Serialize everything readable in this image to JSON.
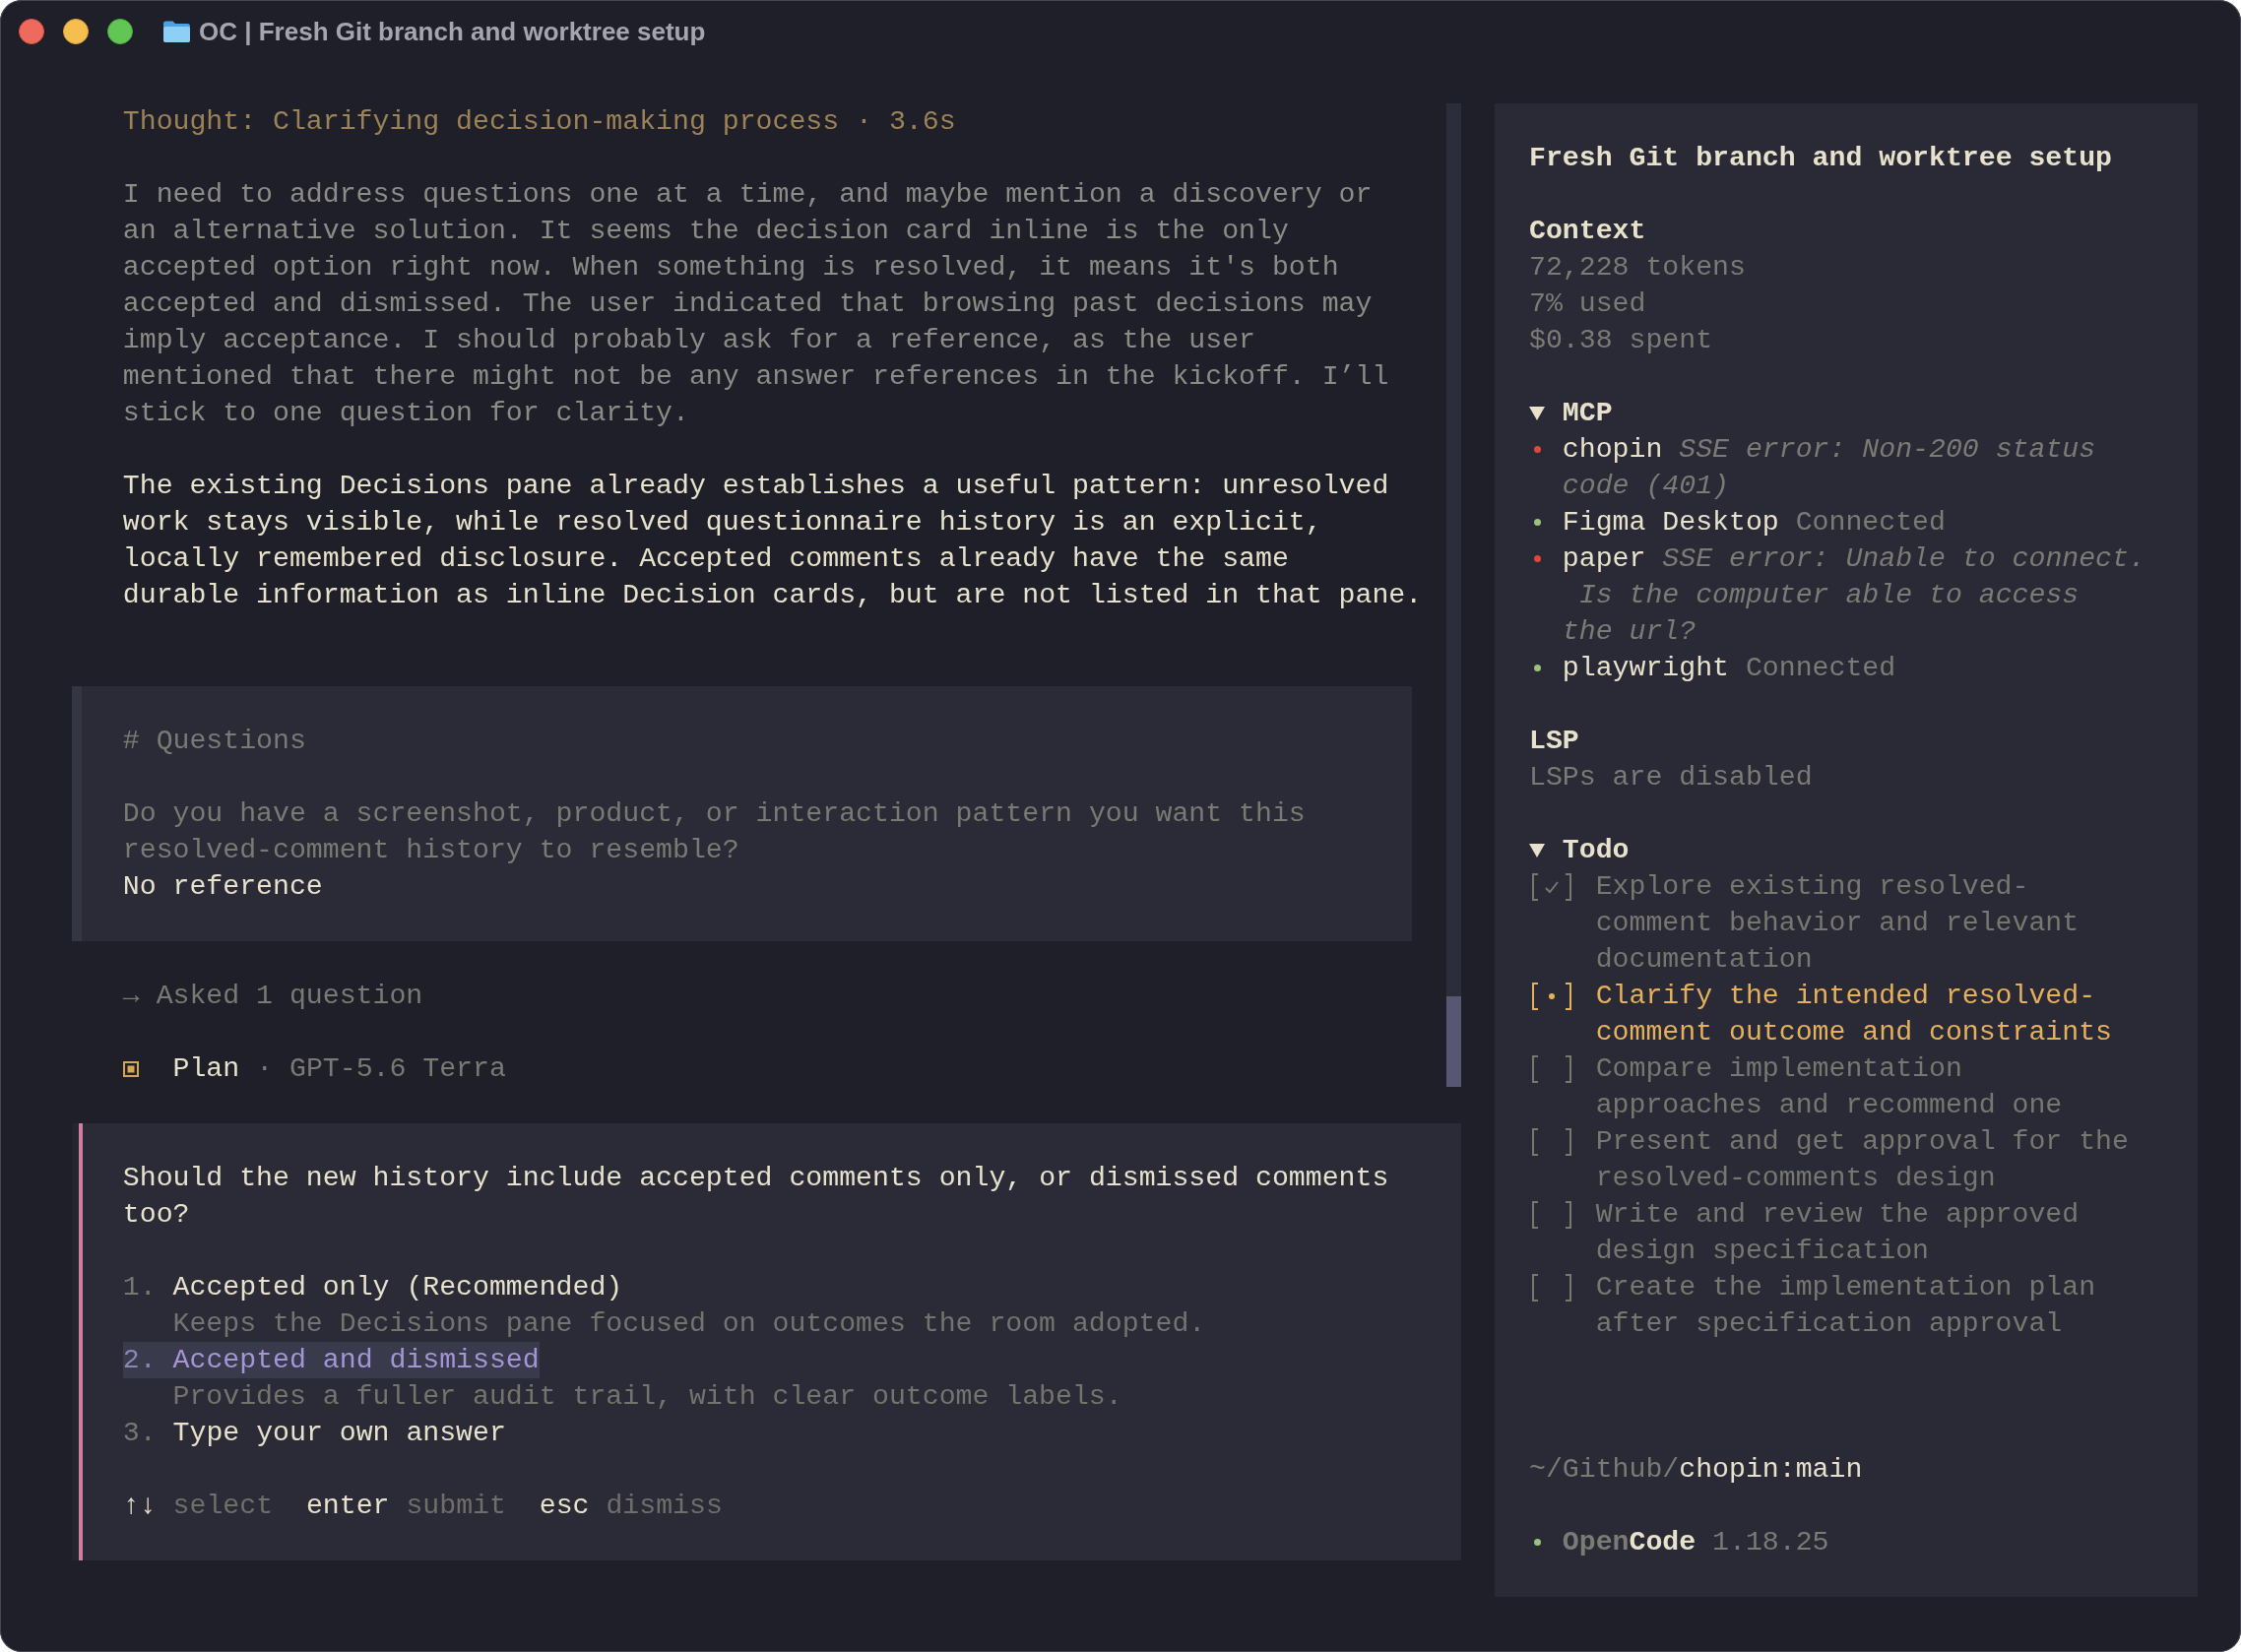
{
  "window": {
    "title": "OC | Fresh Git branch and worktree setup"
  },
  "thread": {
    "thought": "Thought: Clarifying decision-making process · 3.6s",
    "reasoning": "I need to address questions one at a time, and maybe mention a discovery or\nan alternative solution. It seems the decision card inline is the only\naccepted option right now. When something is resolved, it means it's both\naccepted and dismissed. The user indicated that browsing past decisions may\nimply acceptance. I should probably ask for a reference, as the user\nmentioned that there might not be any answer references in the kickoff. I’ll\nstick to one question for clarity.",
    "response": "The existing Decisions pane already establishes a useful pattern: unresolved\nwork stays visible, while resolved questionnaire history is an explicit,\nlocally remembered disclosure. Accepted comments already have the same\ndurable information as inline Decision cards, but are not listed in that pane.",
    "questions": {
      "heading": "# Questions",
      "question": "Do you have a screenshot, product, or interaction pattern you want this\nresolved-comment history to resemble?",
      "answer": "No reference"
    },
    "tool_call": "→ Asked 1 question",
    "agent": {
      "mode": "Plan",
      "separator": "·",
      "model": "GPT-5.6 Terra"
    }
  },
  "prompt": {
    "question": "Should the new history include accepted comments only, or dismissed comments\ntoo?",
    "options": [
      {
        "number": "1.",
        "label": "Accepted only (Recommended)",
        "description": "Keeps the Decisions pane focused on outcomes the room adopted.",
        "selected": false
      },
      {
        "number": "2.",
        "label": "Accepted and dismissed",
        "description": "Provides a fuller audit trail, with clear outcome labels.",
        "selected": true
      },
      {
        "number": "3.",
        "label": "Type your own answer",
        "selected": false
      }
    ],
    "hints": [
      {
        "key": "↑↓",
        "action": "select"
      },
      {
        "key": "enter",
        "action": "submit"
      },
      {
        "key": "esc",
        "action": "dismiss"
      }
    ]
  },
  "sidebar": {
    "title": "Fresh Git branch and worktree setup",
    "context": {
      "heading": "Context",
      "lines": [
        "72,228 tokens",
        "7% used",
        "$0.38 spent"
      ]
    },
    "mcp": {
      "heading": "MCP",
      "expanded": true,
      "servers": [
        {
          "name": "chopin",
          "status": "SSE error: Non-200 status\ncode (401)",
          "kind": "error",
          "color": "#e0473c"
        },
        {
          "name": "Figma Desktop",
          "status": "Connected",
          "kind": "connected",
          "color": "#9cc17e"
        },
        {
          "name": "paper",
          "status": "SSE error: Unable to connect.\n Is the computer able to access\nthe url?",
          "kind": "error",
          "color": "#e0473c"
        },
        {
          "name": "playwright",
          "status": "Connected",
          "kind": "connected",
          "color": "#9cc17e"
        }
      ]
    },
    "lsp": {
      "heading": "LSP",
      "text": "LSPs are disabled"
    },
    "todo": {
      "heading": "Todo",
      "expanded": true,
      "items": [
        {
          "done": true,
          "active": false,
          "text": "Explore existing resolved-comment behavior and relevant documentation"
        },
        {
          "done": false,
          "active": true,
          "text": "Clarify the intended resolved-comment outcome and constraints"
        },
        {
          "done": false,
          "active": false,
          "text": "Compare implementation approaches and recommend one"
        },
        {
          "done": false,
          "active": false,
          "text": "Present and get approval for the resolved-comments design"
        },
        {
          "done": false,
          "active": false,
          "text": "Write and review the approved design specification"
        },
        {
          "done": false,
          "active": false,
          "text": "Create the implementation plan after specification approval"
        }
      ]
    },
    "footer": {
      "directory": "~/Github/",
      "branch": "chopin:main"
    },
    "version": {
      "color": "#9cc17e",
      "app_name": [
        "Open",
        "Code"
      ],
      "number": "1.18.25"
    }
  }
}
